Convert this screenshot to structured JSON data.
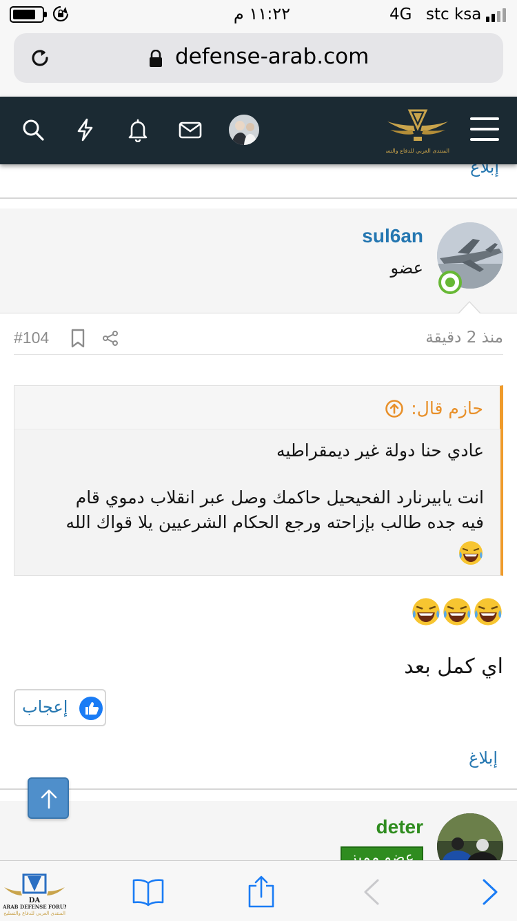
{
  "status_bar": {
    "time": "١١:٢٢ م",
    "network": "4G",
    "carrier": "stc ksa"
  },
  "browser": {
    "url": "defense-arab.com"
  },
  "site_header": {
    "logo_text": "المنتدى العربي للدفاع والتسليح",
    "icons": [
      "search-icon",
      "flash-icon",
      "bell-icon",
      "mail-icon",
      "avatar",
      "menu-icon"
    ]
  },
  "top_report_label": "إبلاغ",
  "post": {
    "author": "sul6an",
    "author_title": "عضو",
    "number": "#104",
    "time": "منذ 2 دقيقة",
    "quote": {
      "author_label": "حازم قال:",
      "line1": "عادي حنا دولة غير ديمقراطيه",
      "line2": "انت يابيرنارد الفحيحيل حاكمك وصل عبر انقلاب دموي قام",
      "line3": "فيه جده طالب بإزاحته ورجع الحكام الشرعيين يلا قواك الله"
    },
    "text": "اي كمل بعد",
    "like_label": "إعجاب",
    "report_label": "إبلاغ"
  },
  "next_post": {
    "author": "deter",
    "badge": "عضو مميز"
  },
  "toolbar": {
    "logo_text": "ARAB DEFENSE FORUM",
    "logo_sub": "المنتدى العربي للدفاع والتسليح",
    "items": [
      "bookmarks-icon",
      "share-icon",
      "back-icon",
      "forward-icon"
    ]
  },
  "colors": {
    "header_bg": "#1b2a33",
    "link_blue": "#2577b1",
    "quote_orange": "#e8902a",
    "online_green": "#67b835",
    "staff_green": "#2f8c1f",
    "ios_blue": "#1a7cf5"
  }
}
